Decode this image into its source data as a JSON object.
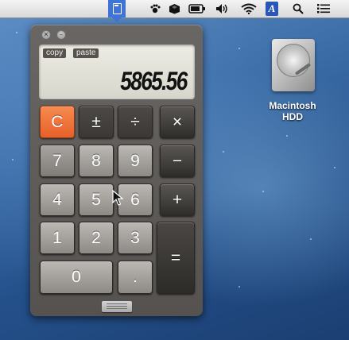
{
  "menubar": {
    "icons": [
      "calculator-icon",
      "paw-icon",
      "box-icon",
      "battery-icon",
      "volume-icon",
      "wifi-icon",
      "text-input-icon",
      "search-icon",
      "list-icon"
    ],
    "input_letter": "A"
  },
  "calculator": {
    "window_buttons": [
      "close",
      "minimize"
    ],
    "close_glyph": "✕",
    "minimize_glyph": "–",
    "copy_label": "copy",
    "paste_label": "paste",
    "display_value": "5865.56",
    "keys": {
      "clear": "C",
      "plus_minus": "±",
      "divide": "÷",
      "multiply": "×",
      "seven": "7",
      "eight": "8",
      "nine": "9",
      "minus": "−",
      "four": "4",
      "five": "5",
      "six": "6",
      "plus": "+",
      "one": "1",
      "two": "2",
      "three": "3",
      "equals": "=",
      "zero": "0",
      "decimal": "."
    },
    "accent_color": "#e8602a"
  },
  "desktop": {
    "drive_label_line1": "Macintosh",
    "drive_label_line2": "HDD"
  }
}
